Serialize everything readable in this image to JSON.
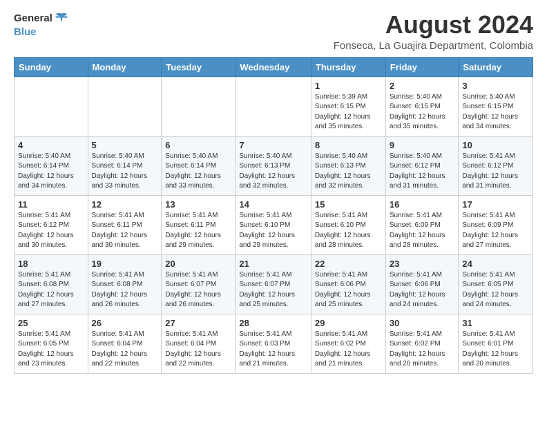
{
  "logo": {
    "line1": "General",
    "line2": "Blue"
  },
  "title": "August 2024",
  "location": "Fonseca, La Guajira Department, Colombia",
  "days_of_week": [
    "Sunday",
    "Monday",
    "Tuesday",
    "Wednesday",
    "Thursday",
    "Friday",
    "Saturday"
  ],
  "weeks": [
    [
      {
        "day": "",
        "info": ""
      },
      {
        "day": "",
        "info": ""
      },
      {
        "day": "",
        "info": ""
      },
      {
        "day": "",
        "info": ""
      },
      {
        "day": "1",
        "info": "Sunrise: 5:39 AM\nSunset: 6:15 PM\nDaylight: 12 hours\nand 35 minutes."
      },
      {
        "day": "2",
        "info": "Sunrise: 5:40 AM\nSunset: 6:15 PM\nDaylight: 12 hours\nand 35 minutes."
      },
      {
        "day": "3",
        "info": "Sunrise: 5:40 AM\nSunset: 6:15 PM\nDaylight: 12 hours\nand 34 minutes."
      }
    ],
    [
      {
        "day": "4",
        "info": "Sunrise: 5:40 AM\nSunset: 6:14 PM\nDaylight: 12 hours\nand 34 minutes."
      },
      {
        "day": "5",
        "info": "Sunrise: 5:40 AM\nSunset: 6:14 PM\nDaylight: 12 hours\nand 33 minutes."
      },
      {
        "day": "6",
        "info": "Sunrise: 5:40 AM\nSunset: 6:14 PM\nDaylight: 12 hours\nand 33 minutes."
      },
      {
        "day": "7",
        "info": "Sunrise: 5:40 AM\nSunset: 6:13 PM\nDaylight: 12 hours\nand 32 minutes."
      },
      {
        "day": "8",
        "info": "Sunrise: 5:40 AM\nSunset: 6:13 PM\nDaylight: 12 hours\nand 32 minutes."
      },
      {
        "day": "9",
        "info": "Sunrise: 5:40 AM\nSunset: 6:12 PM\nDaylight: 12 hours\nand 31 minutes."
      },
      {
        "day": "10",
        "info": "Sunrise: 5:41 AM\nSunset: 6:12 PM\nDaylight: 12 hours\nand 31 minutes."
      }
    ],
    [
      {
        "day": "11",
        "info": "Sunrise: 5:41 AM\nSunset: 6:12 PM\nDaylight: 12 hours\nand 30 minutes."
      },
      {
        "day": "12",
        "info": "Sunrise: 5:41 AM\nSunset: 6:11 PM\nDaylight: 12 hours\nand 30 minutes."
      },
      {
        "day": "13",
        "info": "Sunrise: 5:41 AM\nSunset: 6:11 PM\nDaylight: 12 hours\nand 29 minutes."
      },
      {
        "day": "14",
        "info": "Sunrise: 5:41 AM\nSunset: 6:10 PM\nDaylight: 12 hours\nand 29 minutes."
      },
      {
        "day": "15",
        "info": "Sunrise: 5:41 AM\nSunset: 6:10 PM\nDaylight: 12 hours\nand 28 minutes."
      },
      {
        "day": "16",
        "info": "Sunrise: 5:41 AM\nSunset: 6:09 PM\nDaylight: 12 hours\nand 28 minutes."
      },
      {
        "day": "17",
        "info": "Sunrise: 5:41 AM\nSunset: 6:09 PM\nDaylight: 12 hours\nand 27 minutes."
      }
    ],
    [
      {
        "day": "18",
        "info": "Sunrise: 5:41 AM\nSunset: 6:08 PM\nDaylight: 12 hours\nand 27 minutes."
      },
      {
        "day": "19",
        "info": "Sunrise: 5:41 AM\nSunset: 6:08 PM\nDaylight: 12 hours\nand 26 minutes."
      },
      {
        "day": "20",
        "info": "Sunrise: 5:41 AM\nSunset: 6:07 PM\nDaylight: 12 hours\nand 26 minutes."
      },
      {
        "day": "21",
        "info": "Sunrise: 5:41 AM\nSunset: 6:07 PM\nDaylight: 12 hours\nand 25 minutes."
      },
      {
        "day": "22",
        "info": "Sunrise: 5:41 AM\nSunset: 6:06 PM\nDaylight: 12 hours\nand 25 minutes."
      },
      {
        "day": "23",
        "info": "Sunrise: 5:41 AM\nSunset: 6:06 PM\nDaylight: 12 hours\nand 24 minutes."
      },
      {
        "day": "24",
        "info": "Sunrise: 5:41 AM\nSunset: 6:05 PM\nDaylight: 12 hours\nand 24 minutes."
      }
    ],
    [
      {
        "day": "25",
        "info": "Sunrise: 5:41 AM\nSunset: 6:05 PM\nDaylight: 12 hours\nand 23 minutes."
      },
      {
        "day": "26",
        "info": "Sunrise: 5:41 AM\nSunset: 6:04 PM\nDaylight: 12 hours\nand 22 minutes."
      },
      {
        "day": "27",
        "info": "Sunrise: 5:41 AM\nSunset: 6:04 PM\nDaylight: 12 hours\nand 22 minutes."
      },
      {
        "day": "28",
        "info": "Sunrise: 5:41 AM\nSunset: 6:03 PM\nDaylight: 12 hours\nand 21 minutes."
      },
      {
        "day": "29",
        "info": "Sunrise: 5:41 AM\nSunset: 6:02 PM\nDaylight: 12 hours\nand 21 minutes."
      },
      {
        "day": "30",
        "info": "Sunrise: 5:41 AM\nSunset: 6:02 PM\nDaylight: 12 hours\nand 20 minutes."
      },
      {
        "day": "31",
        "info": "Sunrise: 5:41 AM\nSunset: 6:01 PM\nDaylight: 12 hours\nand 20 minutes."
      }
    ]
  ],
  "colors": {
    "header_bg": "#4a90c4",
    "accent": "#4a90c4"
  }
}
